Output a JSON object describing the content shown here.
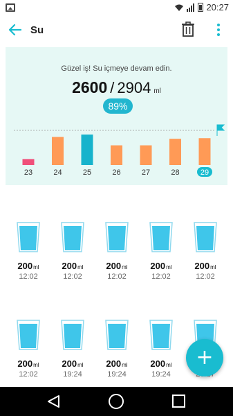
{
  "status_bar": {
    "time": "20:27"
  },
  "app_bar": {
    "title": "Su"
  },
  "summary": {
    "message": "Güzel iş! Su içmeye devam edin.",
    "current": "2600",
    "separator": "/",
    "goal": "2904",
    "unit": "ml",
    "percent": "89%"
  },
  "chart_data": {
    "type": "bar",
    "categories": [
      "23",
      "24",
      "25",
      "26",
      "27",
      "28",
      "29"
    ],
    "values": [
      500,
      2350,
      2550,
      1650,
      1650,
      2200,
      2250
    ],
    "goal": 2904,
    "colors": [
      "#f0507a",
      "#ff9a56",
      "#17b3cc",
      "#ff9a56",
      "#ff9a56",
      "#ff9a56",
      "#ff9a56"
    ],
    "selected_index": 6,
    "title": "",
    "xlabel": "",
    "ylabel": ""
  },
  "drinks": [
    {
      "amount": "200",
      "unit": "ml",
      "time": "12:02"
    },
    {
      "amount": "200",
      "unit": "ml",
      "time": "12:02"
    },
    {
      "amount": "200",
      "unit": "ml",
      "time": "12:02"
    },
    {
      "amount": "200",
      "unit": "ml",
      "time": "12:02"
    },
    {
      "amount": "200",
      "unit": "ml",
      "time": "12:02"
    },
    {
      "amount": "200",
      "unit": "ml",
      "time": "12:02"
    },
    {
      "amount": "200",
      "unit": "ml",
      "time": "19:24"
    },
    {
      "amount": "200",
      "unit": "ml",
      "time": "19:24"
    },
    {
      "amount": "200",
      "unit": "ml",
      "time": "19:24"
    },
    {
      "amount": "200",
      "unit": "ml",
      "time": "20:27"
    }
  ],
  "fab": {
    "label": "+"
  },
  "colors": {
    "accent": "#19bcd0",
    "card_bg": "#e6f8f5",
    "cup": "#3fc6ea"
  }
}
